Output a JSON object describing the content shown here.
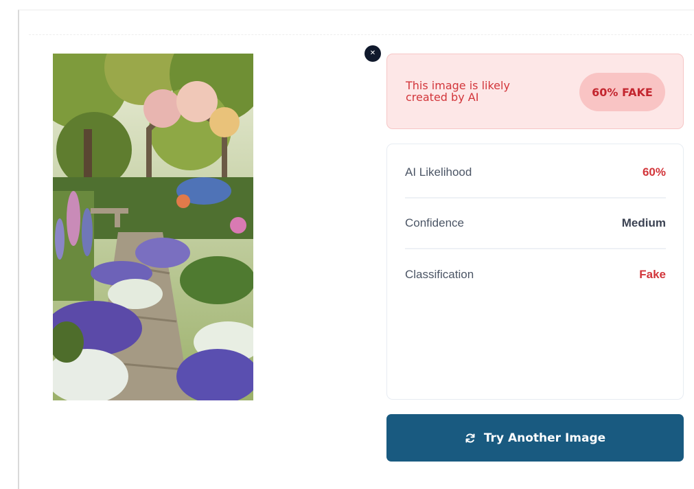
{
  "close_button": {
    "icon": "close-icon",
    "glyph": "✕"
  },
  "result_alert": {
    "message": "This image is likely created by AI",
    "badge": "60% FAKE",
    "colors": {
      "background": "#fde7e7",
      "text": "#d2353a",
      "badge_bg": "#f9c4c4"
    }
  },
  "stats": [
    {
      "label": "AI Likelihood",
      "value": "60%",
      "color": "#d2353a"
    },
    {
      "label": "Confidence",
      "value": "Medium",
      "color": "#3b4252"
    },
    {
      "label": "Classification",
      "value": "Fake",
      "color": "#d2353a"
    }
  ],
  "action_button": {
    "label": "Try Another Image",
    "icon": "refresh-icon",
    "color": "#195a80"
  },
  "image": {
    "subject": "garden-path-photo"
  }
}
